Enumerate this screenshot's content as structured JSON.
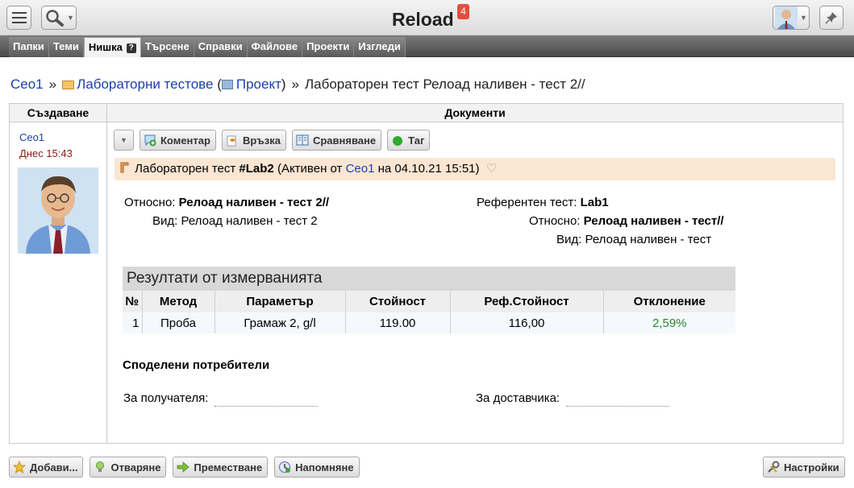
{
  "app": {
    "title": "Reload",
    "notifications": "4"
  },
  "tabs": [
    "Папки",
    "Теми",
    "Нишка",
    "Търсене",
    "Справки",
    "Файлове",
    "Проекти",
    "Изгледи"
  ],
  "breadcrumb": {
    "root": "Ceo1",
    "folder": "Лабораторни тестове",
    "project": "Проект",
    "current": "Лабораторен тест Релоад наливен - тест 2//"
  },
  "columns": {
    "left": "Създаване",
    "right": "Документи"
  },
  "author": {
    "name": "Ceo1",
    "created": "Днес 15:43"
  },
  "toolbar": {
    "comment": "Коментар",
    "link": "Връзка",
    "compare": "Сравняване",
    "tag": "Таг"
  },
  "document": {
    "type": "Лабораторен тест",
    "number": "#Lab2",
    "status_prefix": "(Активен от",
    "author": "Ceo1",
    "date_text": "на 04.10.21 15:51)"
  },
  "fields": {
    "regarding_label": "Относно:",
    "regarding_value": "Релоад наливен - тест 2//",
    "kind_label": "Вид:",
    "kind_value": "Релоад наливен - тест 2",
    "ref_test_label": "Референтен тест:",
    "ref_test_value": "Lab1",
    "ref_regarding_label": "Относно:",
    "ref_regarding_value": "Релоад наливен - тест//",
    "ref_kind_label": "Вид:",
    "ref_kind_value": "Релоад наливен - тест"
  },
  "results": {
    "title": "Резултати от измерванията",
    "headers": [
      "№",
      "Метод",
      "Параметър",
      "Стойност",
      "Реф.Стойност",
      "Отклонение"
    ],
    "rows": [
      [
        "1",
        "Проба",
        "Грамаж 2, g/l",
        "119.00",
        "116,00",
        "2,59%"
      ]
    ]
  },
  "shared": {
    "title": "Споделени потребители",
    "recipient_label": "За получателя:",
    "supplier_label": "За доставчика:"
  },
  "bottom": {
    "add": "Добави...",
    "open": "Отваряне",
    "move": "Преместване",
    "remind": "Напомняне",
    "settings": "Настройки"
  },
  "colors": {
    "link": "#1a3fb0",
    "doc_header_bg": "#fae6d2",
    "deviation": "#2a8a2a",
    "badge": "#e74c3c"
  }
}
